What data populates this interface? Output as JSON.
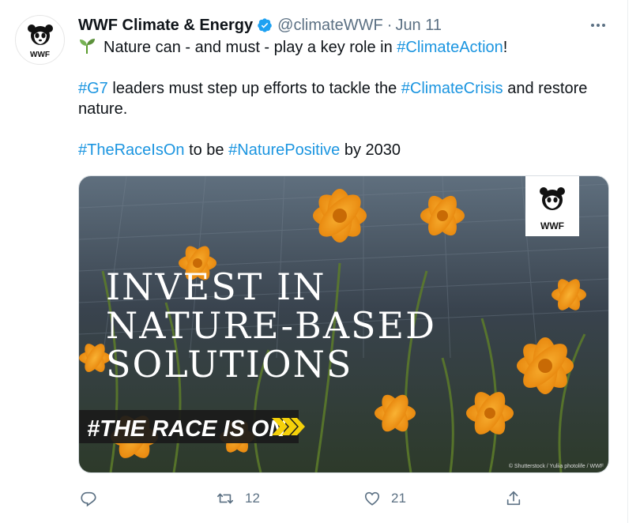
{
  "tweet": {
    "account": {
      "display_name": "WWF Climate & Energy",
      "handle": "@climateWWF",
      "separator": "·",
      "date": "Jun 11",
      "avatar_logo_text": "WWF",
      "verified": true
    },
    "text": {
      "line1_text": "Nature can - and must - play a key role in ",
      "line1_tag": "#ClimateAction",
      "line1_end": "!",
      "line2_tag1": "#G7",
      "line2_text1": " leaders must step up efforts to tackle the ",
      "line2_tag2": "#ClimateCrisis",
      "line2_text2": " and restore nature.",
      "line3_tag1": "#TheRaceIsOn",
      "line3_text1": " to be ",
      "line3_tag2": "#NaturePositive",
      "line3_text2": " by 2030"
    },
    "media": {
      "headline_line1": "INVEST IN",
      "headline_line2": "NATURE-BASED",
      "headline_line3": "SOLUTIONS",
      "banner": "#THE RACE IS ON",
      "logo_text": "WWF",
      "credit": "© Shutterstock / Yuliia photolife / WWF"
    },
    "actions": {
      "reply_count": "",
      "retweet_count": "12",
      "like_count": "21"
    }
  },
  "colors": {
    "link": "#1b95e0",
    "muted": "#5b7083",
    "verified": "#1da1f2",
    "banner_accent": "#f5d10a"
  }
}
